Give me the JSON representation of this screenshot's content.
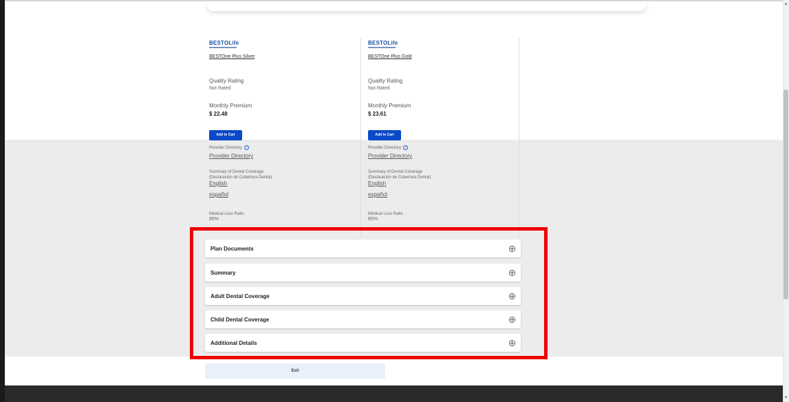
{
  "plans": [
    {
      "logo_text": "BESTOLife",
      "name": "BESTOne Plus Silver",
      "quality_label": "Quality Rating",
      "quality_value": "Not Rated",
      "premium_label": "Monthly Premium",
      "premium_value": "$ 22.48",
      "add_to_cart": "Add to Cart",
      "provider_dir_label": "Provider Directory",
      "provider_dir_link": "Provider Directory",
      "summary_label_1": "Summary of Dental Coverage",
      "summary_label_2": "(Declaración de Cobertura Dental)",
      "english_link": "English",
      "spanish_link": "español",
      "mlr_label": "Medical Loss Ratio",
      "mlr_value": "85%"
    },
    {
      "logo_text": "BESTOLife",
      "name": "BESTOne Plus Gold",
      "quality_label": "Quality Rating",
      "quality_value": "Not Rated",
      "premium_label": "Monthly Premium",
      "premium_value": "$ 23.61",
      "add_to_cart": "Add to Cart",
      "provider_dir_label": "Provider Directory",
      "provider_dir_link": "Provider Directory",
      "summary_label_1": "Summary of Dental Coverage",
      "summary_label_2": "(Declaración de Cobertura Dental)",
      "english_link": "English",
      "spanish_link": "español",
      "mlr_label": "Medical Loss Ratio",
      "mlr_value": "85%"
    }
  ],
  "accordion": [
    {
      "title": "Plan Documents"
    },
    {
      "title": "Summary"
    },
    {
      "title": "Adult Dental Coverage"
    },
    {
      "title": "Child Dental Coverage"
    },
    {
      "title": "Additional Details"
    }
  ],
  "exit_label": "Exit",
  "colors": {
    "primary_button": "#0b49c9",
    "highlight_box": "#ee0000",
    "gray_band": "#ececec",
    "exit_button": "#e8f1fa"
  }
}
